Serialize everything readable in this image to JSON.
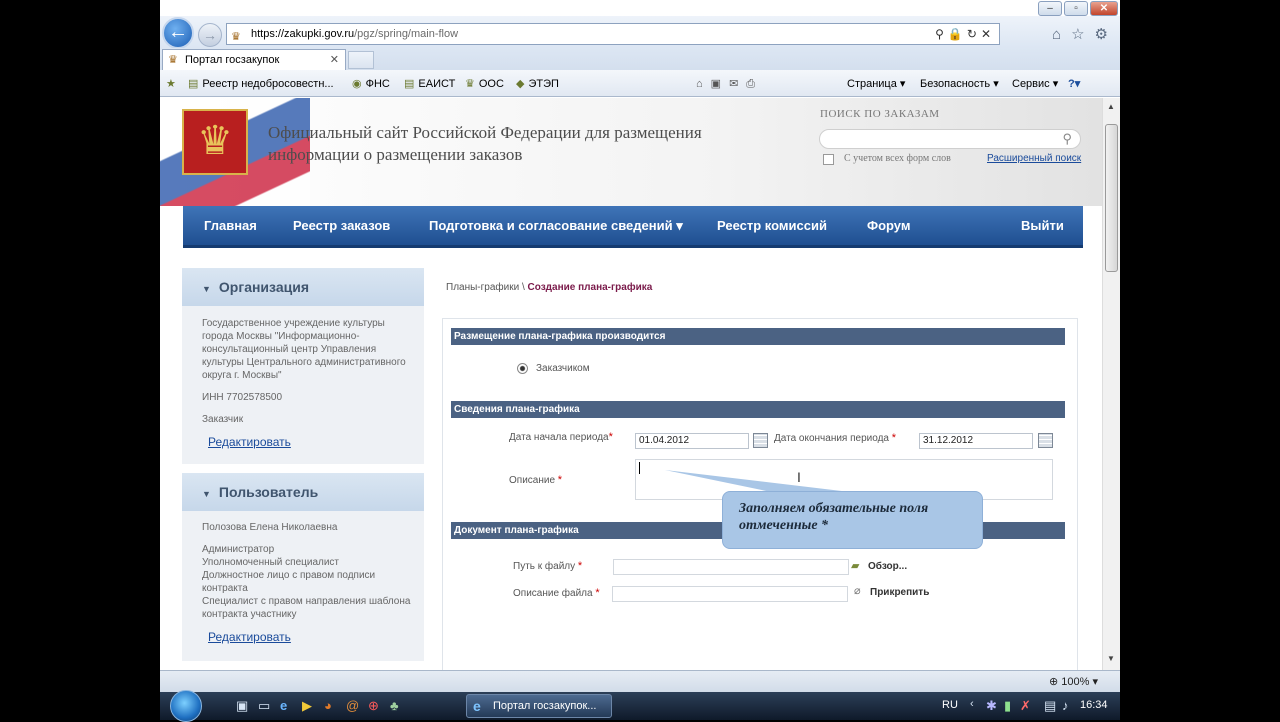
{
  "browser": {
    "url_domain": "https://zakupki.gov.ru",
    "url_path": "/pgz/spring/main-flow",
    "tab_title": "Портал госзакупок",
    "tab_close": "✕",
    "favorites": [
      {
        "label": "Реестр недобросовестн...",
        "icon": "page-icon"
      },
      {
        "label": "ФНС",
        "icon": "emblem-icon"
      },
      {
        "label": "ЕАИСТ",
        "icon": "page-icon"
      },
      {
        "label": "ООС",
        "icon": "emblem-icon"
      },
      {
        "label": "ЭТЭП",
        "icon": "diamond-icon"
      }
    ],
    "commands": {
      "page": "Страница ▾",
      "security": "Безопасность ▾",
      "service": "Сервис ▾"
    },
    "zoom": "100%"
  },
  "header": {
    "title": "Официальный сайт Российской Федерации для размещения информации о размещении заказов",
    "search_label": "ПОИСК ПО ЗАКАЗАМ",
    "search_value": "",
    "all_forms_label": "С учетом всех форм слов",
    "all_forms_checked": false,
    "advanced_search": "Расширенный поиск"
  },
  "menu": {
    "home": "Главная",
    "orders": "Реестр заказов",
    "prep": "Подготовка и согласование сведений",
    "prep_arrow": "▾",
    "commissions": "Реестр комиссий",
    "forum": "Форум",
    "logout": "Выйти"
  },
  "org_panel": {
    "title": "Организация",
    "name": "Государственное учреждение культуры города Москвы \"Информационно-консультационный центр Управления культуры Центрального административного округа г. Москвы\"",
    "inn": "ИНН 7702578500",
    "role": "Заказчик",
    "edit": "Редактировать"
  },
  "user_panel": {
    "title": "Пользователь",
    "name": "Полозова Елена Николаевна",
    "roles": [
      "Администратор",
      "Уполномоченный специалист",
      "Должностное лицо с правом подписи контракта",
      "Специалист с правом направления шаблона контракта участнику"
    ],
    "edit": "Редактировать"
  },
  "breadcrumb": {
    "parent": "Планы-графики",
    "sep": " \\ ",
    "current": "Создание плана-графика"
  },
  "form": {
    "placement_section": "Размещение плана-графика производится",
    "placement_option": "Заказчиком",
    "placement_selected": true,
    "info_section": "Сведения плана-графика",
    "start_label": "Дата начала периода",
    "start_value": "01.04.2012",
    "end_label": "Дата окончания периода",
    "end_value": "31.12.2012",
    "desc_label": "Описание",
    "desc_value": "",
    "doc_section": "Документ плана-графика",
    "file_path_label": "Путь к файлу",
    "file_path_value": "",
    "browse": "Обзор...",
    "file_desc_label": "Описание файла",
    "file_desc_value": "",
    "attach": "Прикрепить",
    "required_mark": "*"
  },
  "callout": {
    "text": "Заполняем обязательные поля отмеченные *"
  },
  "taskbar": {
    "task": "Портал госзакупок...",
    "lang": "RU",
    "time": "16:34"
  }
}
